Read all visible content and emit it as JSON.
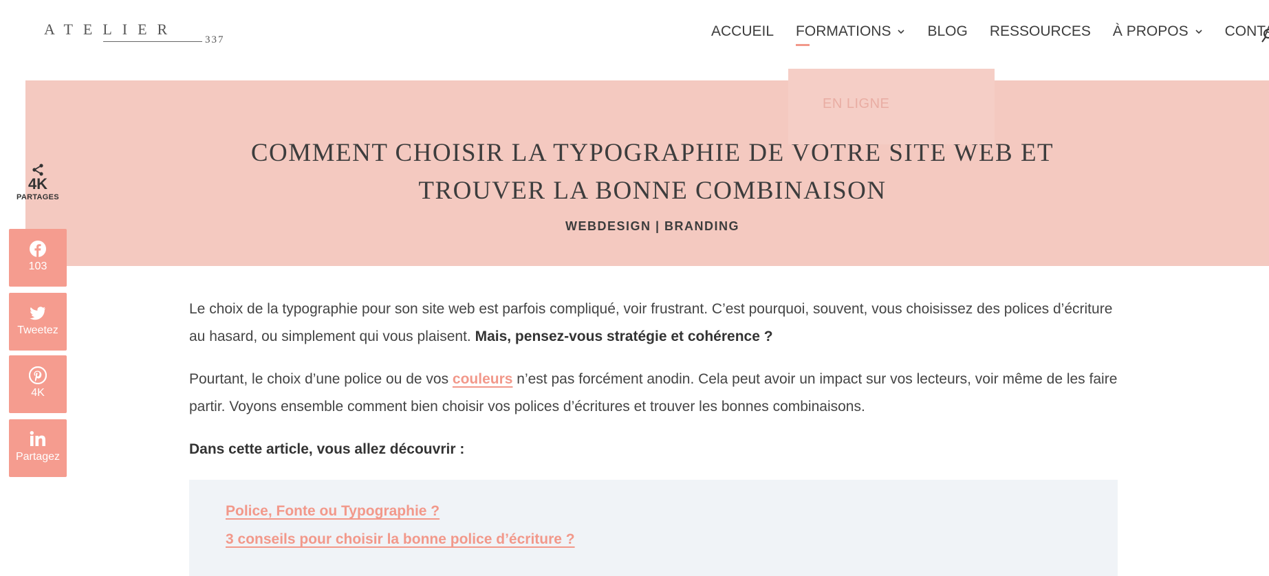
{
  "logo": {
    "word": "ATELIER",
    "number": "337"
  },
  "nav": {
    "items": [
      {
        "label": "ACCUEIL"
      },
      {
        "label": "FORMATIONS"
      },
      {
        "label": "BLOG"
      },
      {
        "label": "RESSOURCES"
      },
      {
        "label": "À PROPOS"
      },
      {
        "label": "CONTACT"
      }
    ],
    "dropdown_item": "EN LIGNE"
  },
  "hero": {
    "title_line1": "COMMENT CHOISIR LA TYPOGRAPHIE DE VOTRE SITE WEB ET",
    "title_line2": "TROUVER LA BONNE COMBINAISON",
    "categories": "WEBDESIGN | BRANDING"
  },
  "share": {
    "total": "4K",
    "total_label": "PARTAGES",
    "facebook": "103",
    "twitter": "Tweetez",
    "pinterest": "4K",
    "linkedin": "Partagez"
  },
  "article": {
    "p1_text": "Le choix de la typographie pour son site web est parfois compliqué, voir frustrant. C’est pourquoi, souvent, vous choisissez des polices d’écriture au hasard, ou simplement qui vous plaisent. ",
    "p1_bold": "Mais, pensez-vous stratégie et cohérence ?",
    "p2_before": "Pourtant, le choix d’une police ou de vos ",
    "p2_link": "couleurs",
    "p2_after": "  n’est pas forcément anodin. Cela peut avoir un impact sur vos lecteurs, voir même de les faire partir. Voyons ensemble comment bien choisir vos polices d’écritures et trouver les bonnes combinaisons.",
    "intro_bold": "Dans cette article, vous allez découvrir :"
  },
  "toc": [
    "Police, Fonte ou Typographie ?",
    "3 conseils pour choisir la bonne police d’écriture ?"
  ],
  "colors": {
    "accent": "#f2988a",
    "hero_bg": "#f4c9c0",
    "share_bg": "#f59c8f",
    "toc_bg": "#f0f3f7"
  }
}
